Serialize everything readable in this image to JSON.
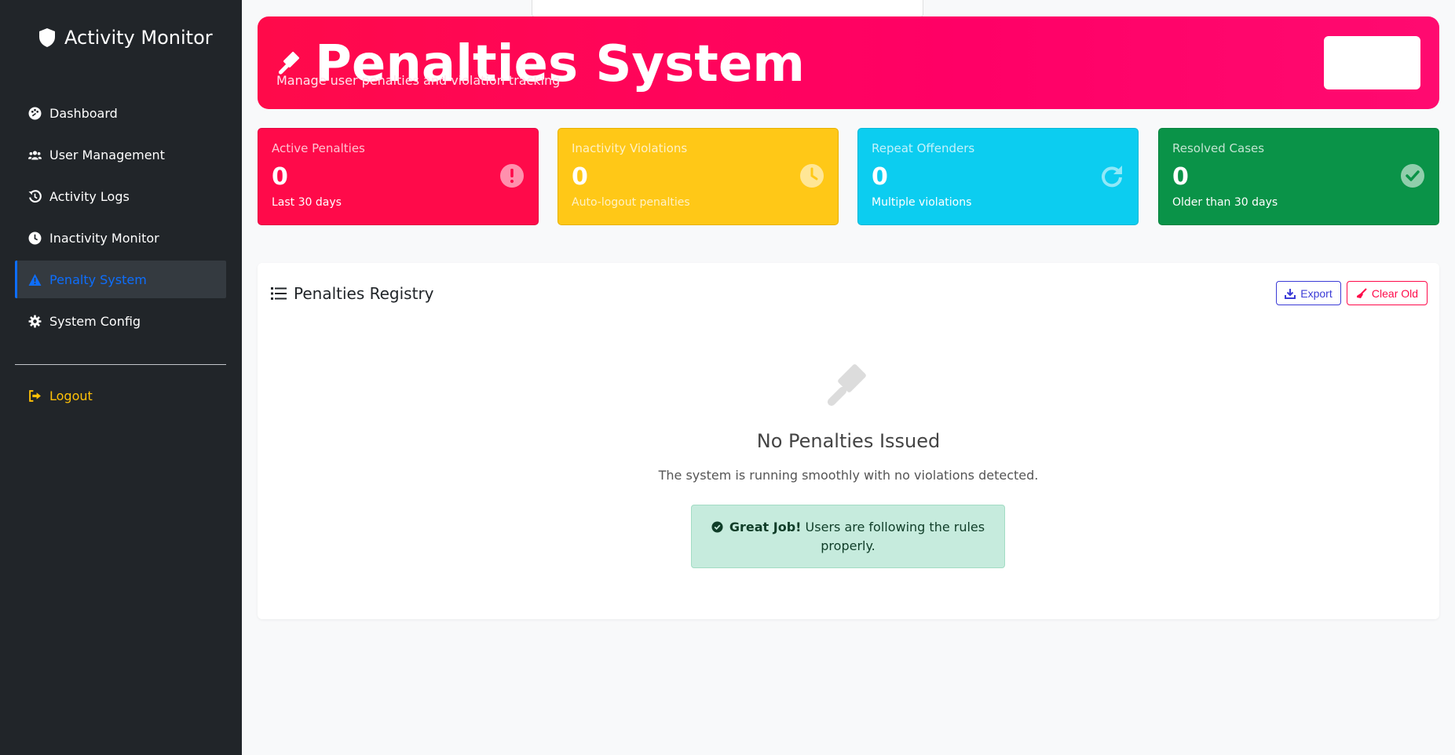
{
  "sidebar": {
    "brand": "Activity Monitor",
    "items": [
      {
        "label": "Dashboard",
        "icon": "palette-icon"
      },
      {
        "label": "User Management",
        "icon": "users-icon"
      },
      {
        "label": "Activity Logs",
        "icon": "history-icon"
      },
      {
        "label": "Inactivity Monitor",
        "icon": "clock-icon"
      },
      {
        "label": "Penalty System",
        "icon": "warning-icon",
        "active": true
      },
      {
        "label": "System Config",
        "icon": "gear-icon"
      }
    ],
    "logout": "Logout"
  },
  "header": {
    "title": "Penalties System",
    "subtitle": "Manage user penalties and violation tracking"
  },
  "stats": [
    {
      "label": "Active Penalties",
      "value": "0",
      "sub": "Last 30 days",
      "icon": "exclamation-circle-icon"
    },
    {
      "label": "Inactivity Violations",
      "value": "0",
      "sub": "Auto-logout penalties",
      "icon": "clock-icon"
    },
    {
      "label": "Repeat Offenders",
      "value": "0",
      "sub": "Multiple violations",
      "icon": "redo-icon"
    },
    {
      "label": "Resolved Cases",
      "value": "0",
      "sub": "Older than 30 days",
      "icon": "check-circle-icon"
    }
  ],
  "registry": {
    "title": "Penalties Registry",
    "export_label": "Export",
    "clear_label": "Clear Old",
    "empty_title": "No Penalties Issued",
    "empty_text": "The system is running smoothly with no violations detected.",
    "alert_strong": "Great Job!",
    "alert_text": " Users are following the rules properly."
  },
  "colors": {
    "sidebar_bg": "#212529",
    "primary": "#0d6efd",
    "danger": "#ff0a4a",
    "warning": "#ffc817",
    "info": "#0ccdf0",
    "success": "#0a9348"
  }
}
